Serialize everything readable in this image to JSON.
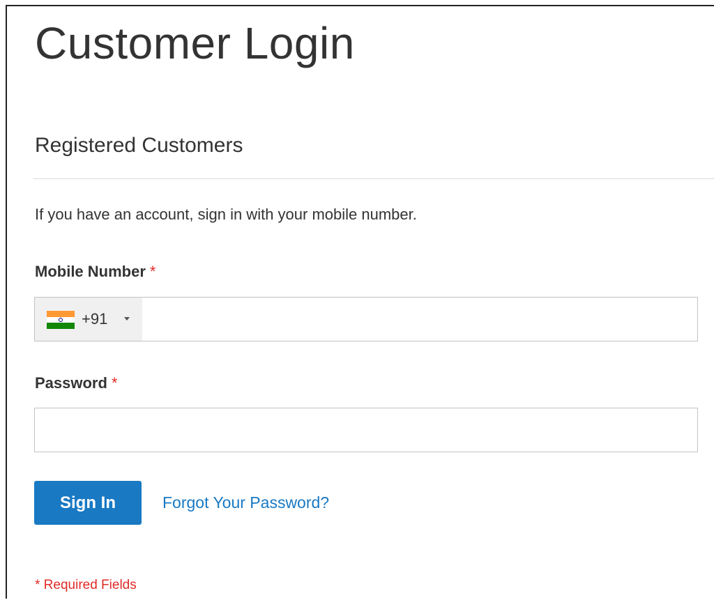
{
  "page": {
    "title": "Customer Login"
  },
  "login_block": {
    "title": "Registered Customers",
    "intro": "If you have an account, sign in with your mobile number.",
    "mobile": {
      "label": "Mobile Number",
      "required_marker": "*",
      "country_flag_icon": "india-flag-icon",
      "dial_code": "+91",
      "value": "",
      "placeholder": ""
    },
    "password": {
      "label": "Password",
      "required_marker": "*",
      "value": "",
      "placeholder": ""
    },
    "actions": {
      "sign_in_label": "Sign In",
      "forgot_password_label": "Forgot Your Password?"
    },
    "required_note": "* Required Fields"
  },
  "colors": {
    "primary": "#1979c3",
    "required": "#e02b27",
    "text": "#333333",
    "border": "#c2c2c2",
    "selector_bg": "#f0f0f0"
  }
}
